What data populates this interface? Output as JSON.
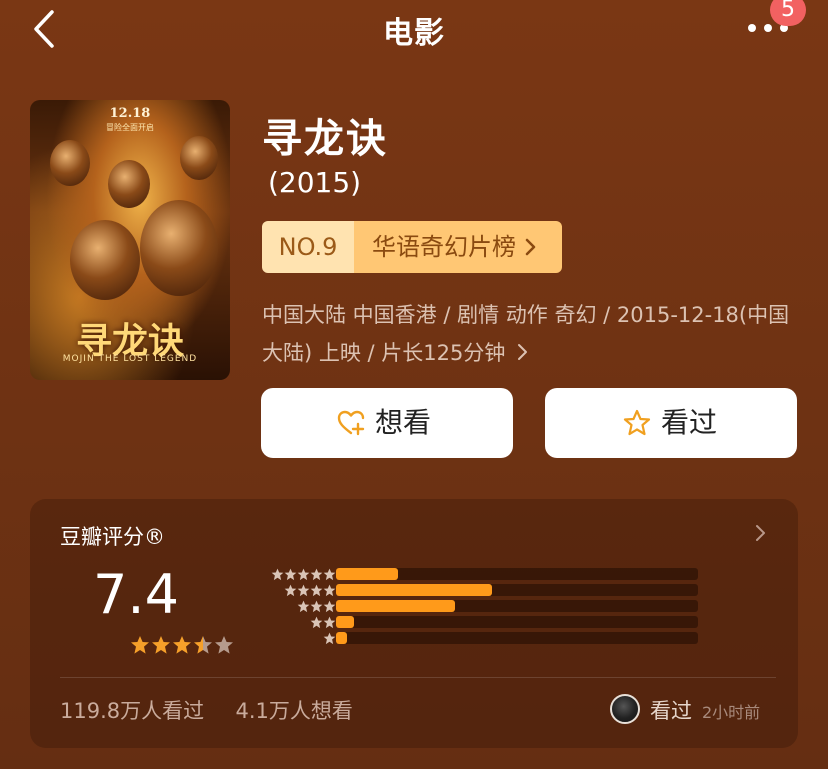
{
  "header": {
    "title": "电影",
    "badge_count": "5"
  },
  "poster": {
    "date_text": "12.18",
    "date_sub": "冒险全面开启",
    "title_text": "寻龙诀",
    "subtitle_text": "MOJIN THE LOST LEGEND"
  },
  "movie": {
    "title": "寻龙诀",
    "year": "(2015)",
    "rank_no": "NO.9",
    "rank_list": "华语奇幻片榜",
    "meta_line1": "中国大陆 中国香港 / 剧情 动作 奇幻 / 2015-12-18(中国",
    "meta_line2": "大陆) 上映 / 片长125分钟"
  },
  "actions": {
    "want_label": "想看",
    "seen_label": "看过"
  },
  "rating": {
    "title": "豆瓣评分®",
    "score": "7.4",
    "stars": 3.5,
    "distribution": [
      {
        "stars": 5,
        "fraction": 0.17
      },
      {
        "stars": 4,
        "fraction": 0.43
      },
      {
        "stars": 3,
        "fraction": 0.33
      },
      {
        "stars": 2,
        "fraction": 0.05
      },
      {
        "stars": 1,
        "fraction": 0.03
      }
    ],
    "seen_count": "119.8万人看过",
    "want_count": "4.1万人想看",
    "friend_status": "看过",
    "friend_time": "2小时前"
  },
  "colors": {
    "background": "#6e3213",
    "accent_orange": "#ff9a1a",
    "rank_light": "#ffe3b0",
    "rank_dark": "#ffc774",
    "badge_red": "#f26161"
  }
}
